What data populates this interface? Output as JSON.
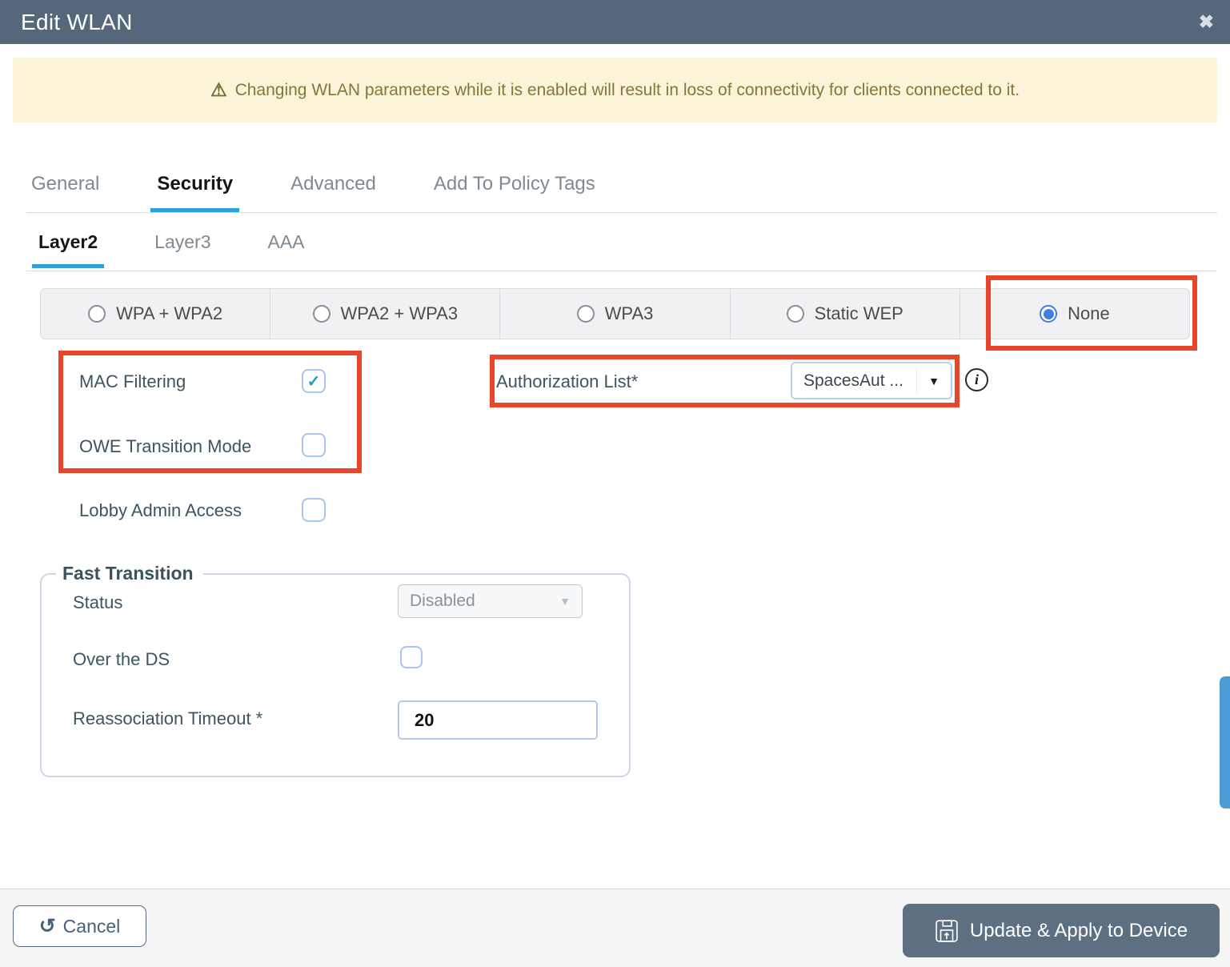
{
  "header": {
    "title": "Edit WLAN"
  },
  "icons": {
    "close": "✖",
    "warning": "⚠",
    "check": "✓",
    "dropdown_arrow": "▼",
    "undo": "↺",
    "info": "i"
  },
  "warning": {
    "message": "Changing WLAN parameters while it is enabled will result in loss of connectivity for clients connected to it."
  },
  "tabs": {
    "items": [
      {
        "label": "General"
      },
      {
        "label": "Security"
      },
      {
        "label": "Advanced"
      },
      {
        "label": "Add To Policy Tags"
      }
    ],
    "active": "Security"
  },
  "subtabs": {
    "items": [
      {
        "label": "Layer2"
      },
      {
        "label": "Layer3"
      },
      {
        "label": "AAA"
      }
    ],
    "active": "Layer2"
  },
  "security_mode": {
    "options": [
      {
        "label": "WPA + WPA2",
        "selected": false
      },
      {
        "label": "WPA2 + WPA3",
        "selected": false
      },
      {
        "label": "WPA3",
        "selected": false
      },
      {
        "label": "Static WEP",
        "selected": false
      },
      {
        "label": "None",
        "selected": true
      }
    ],
    "selected": "None"
  },
  "fields": {
    "mac_filtering": {
      "label": "MAC Filtering",
      "checked": true
    },
    "owe_transition_mode": {
      "label": "OWE Transition Mode",
      "checked": false
    },
    "lobby_admin_access": {
      "label": "Lobby Admin Access",
      "checked": false
    },
    "authorization_list": {
      "label": "Authorization List*",
      "value": "SpacesAut ..."
    }
  },
  "fast_transition": {
    "legend": "Fast Transition",
    "status": {
      "label": "Status",
      "value": "Disabled"
    },
    "over_the_ds": {
      "label": "Over the DS",
      "checked": false
    },
    "reassociation_timeout": {
      "label": "Reassociation Timeout *",
      "value": "20"
    }
  },
  "footer": {
    "cancel_label": "Cancel",
    "update_label": "Update & Apply to Device"
  },
  "colors": {
    "highlight_box": "#e8452a",
    "accent_blue": "#2f9fe0",
    "header_bg": "#55687b",
    "selected_radio": "#3f7de0",
    "scrollbar": "#4b9bd8",
    "warning_bg": "#fbf4d9",
    "warning_text": "#86763a",
    "button_bg": "#5d7082"
  }
}
